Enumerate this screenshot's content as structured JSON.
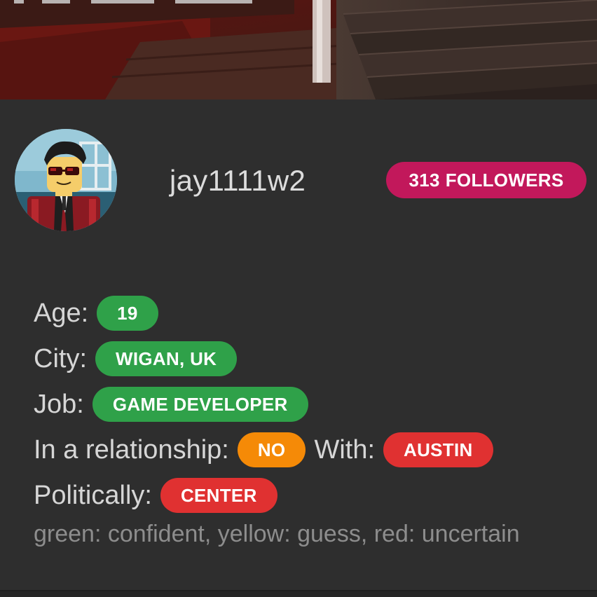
{
  "banner": {
    "image": "game-screenshot-banner"
  },
  "profile": {
    "avatar": "roblox-avatar",
    "username": "jay1111w2",
    "followers": {
      "count": "313",
      "label": "FOLLOWERS"
    }
  },
  "details": {
    "age": {
      "label": "Age:",
      "value": "19",
      "confidence": "green"
    },
    "city": {
      "label": "City:",
      "value": "WIGAN, UK",
      "confidence": "green"
    },
    "job": {
      "label": "Job:",
      "value": "GAME DEVELOPER",
      "confidence": "green"
    },
    "relationship": {
      "label": "In a relationship:",
      "value": "NO",
      "confidence": "yellow",
      "with_label": "With:",
      "with_value": "AUSTIN",
      "with_confidence": "red"
    },
    "politics": {
      "label": "Politically:",
      "value": "CENTER",
      "confidence": "red"
    }
  },
  "legend": "green: confident, yellow: guess, red: uncertain",
  "colors": {
    "background": "#2e2e2e",
    "followers_badge": "#c2185b",
    "confident": "#2fa149",
    "guess": "#f58a07",
    "uncertain": "#e03131",
    "legend_text": "#8d8d8d"
  }
}
